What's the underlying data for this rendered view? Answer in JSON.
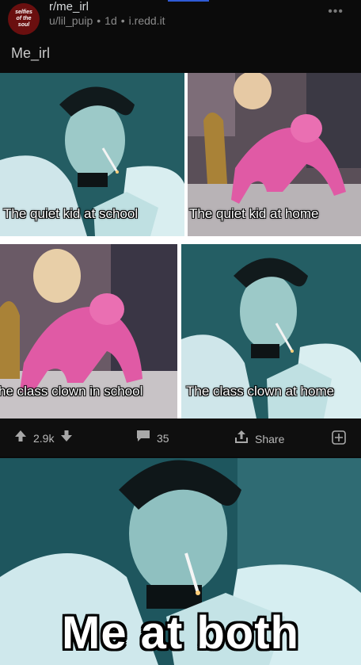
{
  "post": {
    "avatar_text": "selfies\nof the\nsoul",
    "subreddit": "r/me_irl",
    "author": "u/lil_puip",
    "age": "1d",
    "domain": "i.redd.it",
    "more_icon": "ellipsis-icon",
    "title": "Me_irl"
  },
  "meme": {
    "captions": [
      "The quiet kid at school",
      "The quiet kid at home",
      "he class clown in school",
      "The class clown at home"
    ]
  },
  "actions": {
    "votes": "2.9k",
    "comments": "35",
    "share_label": "Share",
    "upvote_icon": "up-arrow-icon",
    "downvote_icon": "down-arrow-icon",
    "comment_icon": "comment-icon",
    "share_icon": "share-icon",
    "award_icon": "add-award-icon"
  },
  "second_image": {
    "caption": "Me at both"
  },
  "colors": {
    "background": "#0b0b0b",
    "teal_photo": "#1f5a62",
    "pink_suit": "#e05aa5"
  }
}
